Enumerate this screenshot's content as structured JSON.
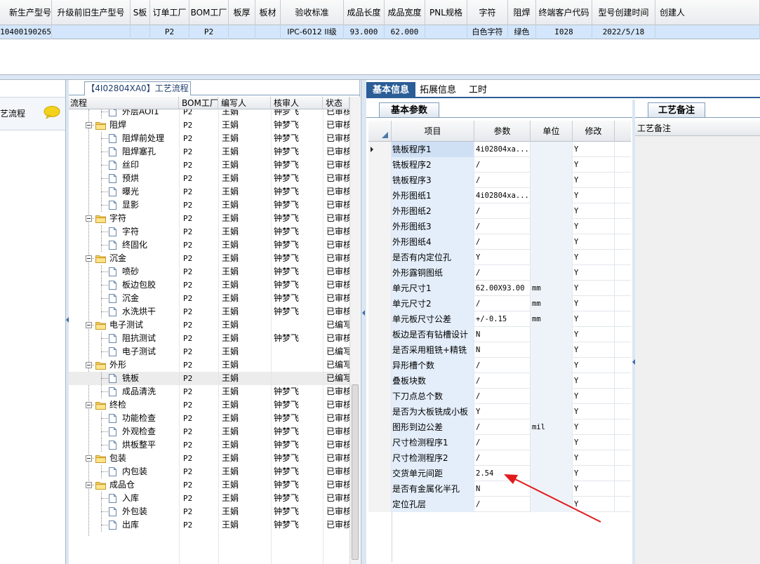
{
  "top_grid": {
    "columns": [
      "新生产型号",
      "升级前旧生产型号",
      "S板",
      "订单工厂",
      "BOM工厂",
      "板厚",
      "板材",
      "验收标准",
      "成品长度",
      "成品宽度",
      "PNL规格",
      "字符",
      "阻焊",
      "终端客户代码",
      "型号创建时间",
      "创建人"
    ],
    "row": [
      "10400190265",
      "",
      "",
      "P2",
      "P2",
      "",
      "",
      "IPC-6012 II级",
      "93.000",
      "62.000",
      "",
      "白色字符",
      "绿色",
      "I028",
      "2022/5/18",
      ""
    ]
  },
  "left_panel": {
    "item_label": "艺流程",
    "icon": "speech-bubble-icon"
  },
  "tree": {
    "title": "【4I02804XA0】工艺流程",
    "columns": [
      "流程",
      "BOM工厂",
      "编写人",
      "核审人",
      "状态"
    ],
    "rows": [
      {
        "level": 2,
        "label": "外层AOI1",
        "bom": "P2",
        "writer": "王娟",
        "reviewer": "钟梦飞",
        "status": "已审核"
      },
      {
        "level": 1,
        "label": "阻焊",
        "bom": "P2",
        "writer": "王娟",
        "reviewer": "钟梦飞",
        "status": "已审核"
      },
      {
        "level": 2,
        "label": "阻焊前处理",
        "bom": "P2",
        "writer": "王娟",
        "reviewer": "钟梦飞",
        "status": "已审核"
      },
      {
        "level": 2,
        "label": "阻焊塞孔",
        "bom": "P2",
        "writer": "王娟",
        "reviewer": "钟梦飞",
        "status": "已审核"
      },
      {
        "level": 2,
        "label": "丝印",
        "bom": "P2",
        "writer": "王娟",
        "reviewer": "钟梦飞",
        "status": "已审核"
      },
      {
        "level": 2,
        "label": "预烘",
        "bom": "P2",
        "writer": "王娟",
        "reviewer": "钟梦飞",
        "status": "已审核"
      },
      {
        "level": 2,
        "label": "曝光",
        "bom": "P2",
        "writer": "王娟",
        "reviewer": "钟梦飞",
        "status": "已审核"
      },
      {
        "level": 2,
        "label": "显影",
        "bom": "P2",
        "writer": "王娟",
        "reviewer": "钟梦飞",
        "status": "已审核"
      },
      {
        "level": 1,
        "label": "字符",
        "bom": "P2",
        "writer": "王娟",
        "reviewer": "钟梦飞",
        "status": "已审核"
      },
      {
        "level": 2,
        "label": "字符",
        "bom": "P2",
        "writer": "王娟",
        "reviewer": "钟梦飞",
        "status": "已审核"
      },
      {
        "level": 2,
        "label": "终固化",
        "bom": "P2",
        "writer": "王娟",
        "reviewer": "钟梦飞",
        "status": "已审核"
      },
      {
        "level": 1,
        "label": "沉金",
        "bom": "P2",
        "writer": "王娟",
        "reviewer": "钟梦飞",
        "status": "已审核"
      },
      {
        "level": 2,
        "label": "喷砂",
        "bom": "P2",
        "writer": "王娟",
        "reviewer": "钟梦飞",
        "status": "已审核"
      },
      {
        "level": 2,
        "label": "板边包胶",
        "bom": "P2",
        "writer": "王娟",
        "reviewer": "钟梦飞",
        "status": "已审核"
      },
      {
        "level": 2,
        "label": "沉金",
        "bom": "P2",
        "writer": "王娟",
        "reviewer": "钟梦飞",
        "status": "已审核"
      },
      {
        "level": 2,
        "label": "水洗烘干",
        "bom": "P2",
        "writer": "王娟",
        "reviewer": "钟梦飞",
        "status": "已审核"
      },
      {
        "level": 1,
        "label": "电子测试",
        "bom": "P2",
        "writer": "王娟",
        "reviewer": "",
        "status": "已编写"
      },
      {
        "level": 2,
        "label": "阻抗测试",
        "bom": "P2",
        "writer": "王娟",
        "reviewer": "钟梦飞",
        "status": "已审核"
      },
      {
        "level": 2,
        "label": "电子测试",
        "bom": "P2",
        "writer": "王娟",
        "reviewer": "",
        "status": "已编写"
      },
      {
        "level": 1,
        "label": "外形",
        "bom": "P2",
        "writer": "王娟",
        "reviewer": "",
        "status": "已编写"
      },
      {
        "level": 2,
        "label": "铣板",
        "bom": "P2",
        "writer": "王娟",
        "reviewer": "",
        "status": "已编写",
        "selected": true
      },
      {
        "level": 2,
        "label": "成品清洗",
        "bom": "P2",
        "writer": "王娟",
        "reviewer": "钟梦飞",
        "status": "已审核"
      },
      {
        "level": 1,
        "label": "终检",
        "bom": "P2",
        "writer": "王娟",
        "reviewer": "钟梦飞",
        "status": "已审核"
      },
      {
        "level": 2,
        "label": "功能检查",
        "bom": "P2",
        "writer": "王娟",
        "reviewer": "钟梦飞",
        "status": "已审核"
      },
      {
        "level": 2,
        "label": "外观检查",
        "bom": "P2",
        "writer": "王娟",
        "reviewer": "钟梦飞",
        "status": "已审核"
      },
      {
        "level": 2,
        "label": "烘板整平",
        "bom": "P2",
        "writer": "王娟",
        "reviewer": "钟梦飞",
        "status": "已审核"
      },
      {
        "level": 1,
        "label": "包装",
        "bom": "P2",
        "writer": "王娟",
        "reviewer": "钟梦飞",
        "status": "已审核"
      },
      {
        "level": 2,
        "label": "内包装",
        "bom": "P2",
        "writer": "王娟",
        "reviewer": "钟梦飞",
        "status": "已审核"
      },
      {
        "level": 1,
        "label": "成品仓",
        "bom": "P2",
        "writer": "王娟",
        "reviewer": "钟梦飞",
        "status": "已审核"
      },
      {
        "level": 2,
        "label": "入库",
        "bom": "P2",
        "writer": "王娟",
        "reviewer": "钟梦飞",
        "status": "已审核"
      },
      {
        "level": 2,
        "label": "外包装",
        "bom": "P2",
        "writer": "王娟",
        "reviewer": "钟梦飞",
        "status": "已审核"
      },
      {
        "level": 2,
        "label": "出库",
        "bom": "P2",
        "writer": "王娟",
        "reviewer": "钟梦飞",
        "status": "已审核"
      }
    ]
  },
  "right_tabs": [
    "基本信息",
    "拓展信息",
    "工时"
  ],
  "params": {
    "tab_label": "基本参数",
    "columns": [
      "项目",
      "参数",
      "单位",
      "修改"
    ],
    "rows": [
      {
        "item": "铣板程序1",
        "value": "4i02804xa...",
        "unit": "",
        "modify": "Y",
        "selected": true
      },
      {
        "item": "铣板程序2",
        "value": "/",
        "unit": "",
        "modify": "Y"
      },
      {
        "item": "铣板程序3",
        "value": "/",
        "unit": "",
        "modify": "Y"
      },
      {
        "item": "外形图纸1",
        "value": "4i02804xa...",
        "unit": "",
        "modify": "Y"
      },
      {
        "item": "外形图纸2",
        "value": "/",
        "unit": "",
        "modify": "Y"
      },
      {
        "item": "外形图纸3",
        "value": "/",
        "unit": "",
        "modify": "Y"
      },
      {
        "item": "外形图纸4",
        "value": "/",
        "unit": "",
        "modify": "Y"
      },
      {
        "item": "是否有内定位孔",
        "value": "Y",
        "unit": "",
        "modify": "Y"
      },
      {
        "item": "外形露铜图纸",
        "value": "/",
        "unit": "",
        "modify": "Y"
      },
      {
        "item": "单元尺寸1",
        "value": "62.00X93.00",
        "unit": "mm",
        "modify": "Y"
      },
      {
        "item": "单元尺寸2",
        "value": "/",
        "unit": "mm",
        "modify": "Y"
      },
      {
        "item": "单元板尺寸公差",
        "value": "+/-0.15",
        "unit": "mm",
        "modify": "Y"
      },
      {
        "item": "板边是否有钻槽设计",
        "value": "N",
        "unit": "",
        "modify": "Y"
      },
      {
        "item": "是否采用粗铣+精铣",
        "value": "N",
        "unit": "",
        "modify": "Y"
      },
      {
        "item": "异形槽个数",
        "value": "/",
        "unit": "",
        "modify": "Y"
      },
      {
        "item": "叠板块数",
        "value": "/",
        "unit": "",
        "modify": "Y"
      },
      {
        "item": "下刀点总个数",
        "value": "/",
        "unit": "",
        "modify": "Y"
      },
      {
        "item": "是否为大板铣成小板",
        "value": "Y",
        "unit": "",
        "modify": "Y"
      },
      {
        "item": "图形到边公差",
        "value": "/",
        "unit": "mil",
        "modify": "Y"
      },
      {
        "item": "尺寸检测程序1",
        "value": "/",
        "unit": "",
        "modify": "Y"
      },
      {
        "item": "尺寸检测程序2",
        "value": "/",
        "unit": "",
        "modify": "Y"
      },
      {
        "item": "交货单元间距",
        "value": "2.54",
        "unit": "",
        "modify": "Y"
      },
      {
        "item": "是否有金属化半孔",
        "value": "N",
        "unit": "",
        "modify": "Y"
      },
      {
        "item": "定位孔层",
        "value": "/",
        "unit": "",
        "modify": "Y"
      }
    ]
  },
  "notes": {
    "tab_label": "工艺备注",
    "header": "工艺备注"
  },
  "colors": {
    "accent": "#2b5d97",
    "selection": "#d4e6fb",
    "annotation_arrow": "#e11b1b"
  }
}
